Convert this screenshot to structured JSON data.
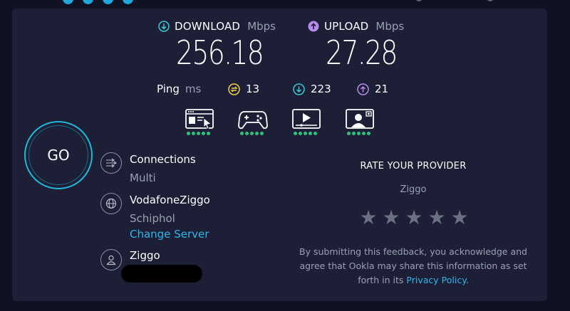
{
  "download": {
    "label": "DOWNLOAD",
    "unit": "Mbps",
    "value": "256.18",
    "color": "#3fc7d6"
  },
  "upload": {
    "label": "UPLOAD",
    "unit": "Mbps",
    "value": "27.28",
    "color": "#b78be8"
  },
  "ping": {
    "label": "Ping",
    "unit": "ms",
    "idle": "13",
    "idle_color": "#f5d04b",
    "download": "223",
    "download_color": "#3fc7d6",
    "upload": "21",
    "upload_color": "#b78be8"
  },
  "use_cases": [
    {
      "icon": "web-browsing-icon",
      "rating": 5
    },
    {
      "icon": "gaming-icon",
      "rating": 5
    },
    {
      "icon": "video-streaming-icon",
      "rating": 5
    },
    {
      "icon": "video-chat-icon",
      "rating": 5
    }
  ],
  "go_button": {
    "label": "GO"
  },
  "connections": {
    "title": "Connections",
    "value": "Multi"
  },
  "server": {
    "name": "VodafoneZiggo",
    "location": "Schiphol",
    "change_label": "Change Server"
  },
  "provider": {
    "name": "Ziggo"
  },
  "rating": {
    "title": "RATE YOUR PROVIDER",
    "provider": "Ziggo",
    "stars": [
      "★",
      "★",
      "★",
      "★",
      "★"
    ],
    "disclaimer_prefix": "By submitting this feedback, you acknowledge and agree that Ookla may share this information as set forth in its ",
    "privacy_link": "Privacy Policy",
    "disclaimer_suffix": "."
  }
}
